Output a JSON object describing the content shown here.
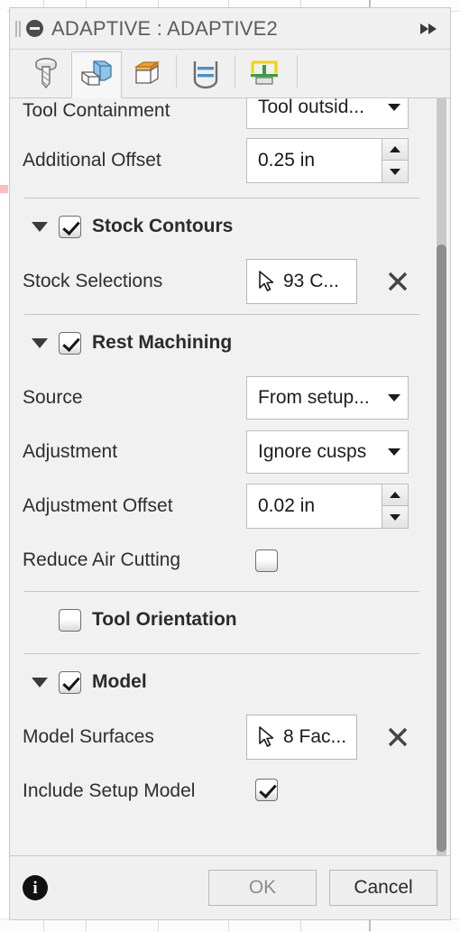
{
  "window": {
    "title": "ADAPTIVE : ADAPTIVE2",
    "state_icon": "collapse-circle-icon",
    "grip_icon": "drag-grip-icon",
    "expand_icon": "fast-forward-icon"
  },
  "tabs": [
    {
      "name": "tool",
      "icon": "endmill-tool-icon",
      "active": false
    },
    {
      "name": "geometry",
      "icon": "geometry-cube-icon",
      "active": true
    },
    {
      "name": "heights",
      "icon": "heights-cube-icon",
      "active": false
    },
    {
      "name": "passes",
      "icon": "passes-icon",
      "active": false
    },
    {
      "name": "linking",
      "icon": "linking-icon",
      "active": false
    }
  ],
  "sections": [
    {
      "id": "top-partial",
      "rows": [
        {
          "type": "dropdown",
          "label": "Tool Containment",
          "value": "Tool outsid...",
          "clipped_top": true
        },
        {
          "type": "spinner",
          "label": "Additional Offset",
          "value": "0.25 in"
        }
      ]
    },
    {
      "id": "stock-contours",
      "header": {
        "title": "Stock Contours",
        "checked": true,
        "expanded": true
      },
      "rows": [
        {
          "type": "selection",
          "label": "Stock Selections",
          "value": "93 C...",
          "clear_label": "✕"
        }
      ]
    },
    {
      "id": "rest-machining",
      "header": {
        "title": "Rest Machining",
        "checked": true,
        "expanded": true
      },
      "rows": [
        {
          "type": "dropdown",
          "label": "Source",
          "value": "From setup..."
        },
        {
          "type": "dropdown",
          "label": "Adjustment",
          "value": "Ignore cusps"
        },
        {
          "type": "spinner",
          "label": "Adjustment Offset",
          "value": "0.02 in"
        },
        {
          "type": "checkbox",
          "label": "Reduce Air Cutting",
          "checked": false
        }
      ]
    },
    {
      "id": "tool-orientation",
      "header": {
        "title": "Tool Orientation",
        "checked": false,
        "expanded": false
      },
      "rows": []
    },
    {
      "id": "model",
      "header": {
        "title": "Model",
        "checked": true,
        "expanded": true
      },
      "rows": [
        {
          "type": "selection",
          "label": "Model Surfaces",
          "value": "8 Fac...",
          "clear_label": "✕"
        },
        {
          "type": "checkbox",
          "label": "Include Setup Model",
          "checked": true
        }
      ]
    }
  ],
  "footer": {
    "info_icon": "info-icon",
    "ok_label": "OK",
    "cancel_label": "Cancel"
  },
  "scrollbar": {
    "orientation": "vertical",
    "thumb_top_pct": 19,
    "thumb_height_pct": 80
  },
  "colors": {
    "panel_bg": "#f0f0f0",
    "content_bg": "#f1f1f1",
    "border": "#c8c8c8",
    "text": "#2e2e2e",
    "title_text": "#5c5c5c",
    "disabled_text": "#8c8c8c",
    "scroll_thumb": "#8e8e8e",
    "accent_blue": "#8fc3e8",
    "accent_orange": "#f0a030",
    "accent_yellow": "#f2d300",
    "accent_green": "#3c9c3c"
  }
}
